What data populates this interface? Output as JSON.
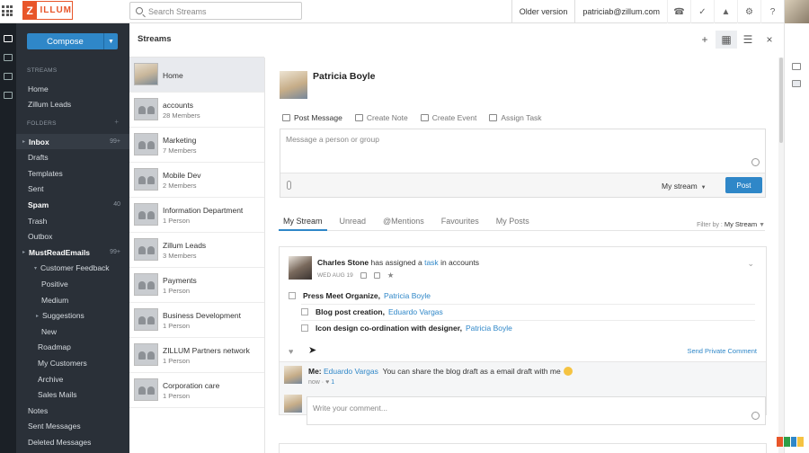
{
  "topbar": {
    "logo_initial": "Z",
    "logo_rest": "ILLUM",
    "search_placeholder": "Search Streams",
    "older_version": "Older version",
    "user_email": "patriciab@zillum.com"
  },
  "sidebar": {
    "compose_label": "Compose",
    "streams_header": "STREAMS",
    "streams": [
      "Home",
      "Zillum Leads"
    ],
    "folders_header": "FOLDERS",
    "folders": [
      {
        "label": "Inbox",
        "count": "99+",
        "bold": true,
        "selected": true,
        "indent": 1
      },
      {
        "label": "Drafts",
        "count": "",
        "indent": 0
      },
      {
        "label": "Templates",
        "count": "",
        "indent": 0
      },
      {
        "label": "Sent",
        "count": "",
        "indent": 0
      },
      {
        "label": "Spam",
        "count": "40",
        "bold": true,
        "indent": 0
      },
      {
        "label": "Trash",
        "count": "",
        "indent": 0
      },
      {
        "label": "Outbox",
        "count": "",
        "indent": 0
      },
      {
        "label": "MustReadEmails",
        "count": "99+",
        "bold": true,
        "indent": 1
      },
      {
        "label": "Customer Feedback",
        "count": "",
        "indent": 2
      },
      {
        "label": "Positive",
        "count": "",
        "indent": 3
      },
      {
        "label": "Medium",
        "count": "",
        "indent": 3
      },
      {
        "label": "Suggestions",
        "count": "",
        "indent": 4
      },
      {
        "label": "New",
        "count": "",
        "indent": 3
      },
      {
        "label": "Roadmap",
        "count": "",
        "indent": 2
      },
      {
        "label": "My Customers",
        "count": "",
        "indent": 2
      },
      {
        "label": "Archive",
        "count": "",
        "indent": 2
      },
      {
        "label": "Sales Mails",
        "count": "",
        "indent": 2
      },
      {
        "label": "Notes",
        "count": "",
        "indent": 0
      },
      {
        "label": "Sent Messages",
        "count": "",
        "indent": 0
      },
      {
        "label": "Deleted Messages",
        "count": "",
        "indent": 0
      }
    ]
  },
  "streams_panel": {
    "title": "Streams",
    "groups": [
      {
        "name": "Home",
        "members": ""
      },
      {
        "name": "accounts",
        "members": "28 Members"
      },
      {
        "name": "Marketing",
        "members": "7 Members"
      },
      {
        "name": "Mobile Dev",
        "members": "2 Members"
      },
      {
        "name": "Information Department",
        "members": "1 Person"
      },
      {
        "name": "Zillum Leads",
        "members": "3 Members"
      },
      {
        "name": "Payments",
        "members": "1 Person"
      },
      {
        "name": "Business Development",
        "members": "1 Person"
      },
      {
        "name": "ZILLUM Partners network",
        "members": "1 Person"
      },
      {
        "name": "Corporation care",
        "members": "1 Person"
      }
    ]
  },
  "main": {
    "profile_name": "Patricia Boyle",
    "actions": [
      "Post Message",
      "Create Note",
      "Create Event",
      "Assign Task"
    ],
    "composer_placeholder": "Message a person or group",
    "stream_select": "My stream",
    "post_label": "Post",
    "feed_tabs": [
      "My Stream",
      "Unread",
      "@Mentions",
      "Favourites",
      "My Posts"
    ],
    "filter_label": "Filter by :",
    "filter_value": "My Stream"
  },
  "card": {
    "author": "Charles Stone",
    "assigned_text": "has assigned a",
    "task_word": "task",
    "in_text": "in accounts",
    "date": "WED AUG 19",
    "tasks": [
      {
        "title": "Press Meet Organize,",
        "assignee": "Patricia Boyle"
      },
      {
        "title": "Blog post creation,",
        "assignee": "Eduardo Vargas"
      },
      {
        "title": "Icon design co-ordination with designer,",
        "assignee": "Patricia Boyle"
      }
    ],
    "private_comment": "Send Private Comment",
    "reply": {
      "me_label": "Me:",
      "mention": "Eduardo Vargas",
      "message": "You can share the blog draft as a email draft with me",
      "time": "now",
      "likes": "1"
    },
    "comment_placeholder": "Write your comment..."
  },
  "colors": {
    "accent": "#2f87c8",
    "brand": "#e8562a",
    "sidebar_bg": "#2a3038"
  }
}
